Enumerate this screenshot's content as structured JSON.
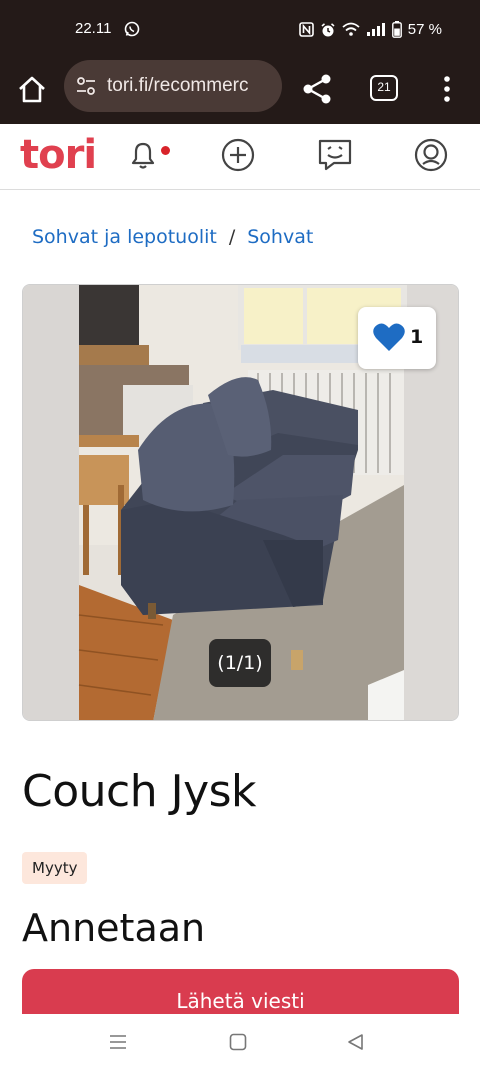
{
  "status_bar": {
    "time": "22.11",
    "battery": "57 %"
  },
  "browser": {
    "url": "tori.fi/recommerc",
    "tab_count": "21"
  },
  "site": {
    "logo": "tori",
    "brand_color": "#e0404f"
  },
  "breadcrumb": {
    "items": [
      "Sohvat ja lepotuolit",
      "Sohvat"
    ],
    "separator": "/"
  },
  "gallery": {
    "favorite_count": "1",
    "counter": "(1/1)"
  },
  "listing": {
    "title": "Couch Jysk",
    "status": "Myyty",
    "price": "Annetaan",
    "send_button": "Lähetä viesti"
  },
  "icons": {
    "status": [
      "whatsapp-icon",
      "nfc-icon",
      "alarm-icon",
      "wifi-icon",
      "signal-icon",
      "battery-icon"
    ],
    "browser": [
      "home-icon",
      "site-settings-icon",
      "share-icon",
      "tabs-icon",
      "more-vert-icon"
    ],
    "nav": [
      "bell-icon",
      "plus-icon",
      "chat-icon",
      "profile-icon"
    ],
    "system": [
      "recents-icon",
      "home-square-icon",
      "back-icon"
    ]
  },
  "colors": {
    "link": "#1e6cc3",
    "cta": "#d93c4f",
    "badge_bg": "#fde7dc",
    "heart": "#1e6cc3"
  }
}
